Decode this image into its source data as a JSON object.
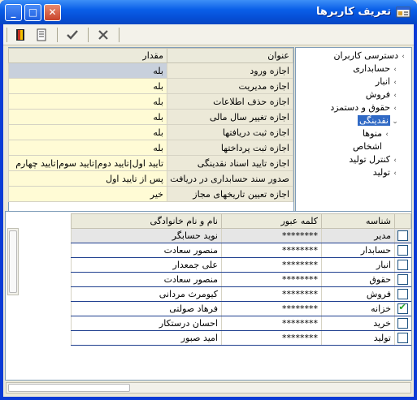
{
  "window": {
    "title": "تعریف کاربرها"
  },
  "tree": {
    "items": [
      {
        "label": "دسترسی کاربران",
        "arrow": "›",
        "indent": 0
      },
      {
        "label": "حسابداری",
        "arrow": "›",
        "indent": 1
      },
      {
        "label": "انبار",
        "arrow": "›",
        "indent": 1
      },
      {
        "label": "فروش",
        "arrow": "›",
        "indent": 1
      },
      {
        "label": "حقوق و دستمزد",
        "arrow": "›",
        "indent": 1
      },
      {
        "label": "نقدینگی",
        "arrow": "⌄",
        "indent": 1,
        "selected": true
      },
      {
        "label": "منوها",
        "arrow": "›",
        "indent": 2
      },
      {
        "label": "اشخاص",
        "arrow": "",
        "indent": 2
      },
      {
        "label": "کنترل تولید",
        "arrow": "›",
        "indent": 1
      },
      {
        "label": "تولید",
        "arrow": "›",
        "indent": 1
      }
    ]
  },
  "permissions": {
    "headers": {
      "title": "عنوان",
      "value": "مقدار"
    },
    "rows": [
      {
        "title": "اجازه ورود",
        "value": "بله"
      },
      {
        "title": "اجازه مدیریت",
        "value": "بله"
      },
      {
        "title": "اجازه حذف اطلاعات",
        "value": "بله"
      },
      {
        "title": "اجازه تغییر سال مالی",
        "value": "بله"
      },
      {
        "title": "اجازه ثبت دریافتها",
        "value": "بله"
      },
      {
        "title": "اجازه ثبت پرداختها",
        "value": "بله"
      },
      {
        "title": "اجازه تایید اسناد نقدینگی",
        "value": "تایید اول|تایید دوم|تایید سوم|تایید چهارم"
      },
      {
        "title": "صدور سند حسابداری در دریافت",
        "value": "پس از تایید اول"
      },
      {
        "title": "اجازه تعیین تاریخهای مجاز",
        "value": "خیر"
      }
    ]
  },
  "users": {
    "headers": {
      "id": "شناسه",
      "password": "کلمه عبور",
      "name": "نام و نام خانوادگی"
    },
    "rows": [
      {
        "id": "مدیر",
        "password": "********",
        "name": "نوید حسابگر",
        "checked": false
      },
      {
        "id": "حسابدار",
        "password": "********",
        "name": "منصور سعادت",
        "checked": false
      },
      {
        "id": "انبار",
        "password": "********",
        "name": "علی جمعدار",
        "checked": false
      },
      {
        "id": "حقوق",
        "password": "********",
        "name": "منصور سعادت",
        "checked": false
      },
      {
        "id": "فروش",
        "password": "********",
        "name": "کیومرث مردانی",
        "checked": false
      },
      {
        "id": "خزانه",
        "password": "********",
        "name": "فرهاد صولتی",
        "checked": true
      },
      {
        "id": "خرید",
        "password": "********",
        "name": "احسان درستکار",
        "checked": false
      },
      {
        "id": "تولید",
        "password": "********",
        "name": "امید صبور",
        "checked": false
      }
    ]
  },
  "icons": [
    "app-icon",
    "exit-door-icon",
    "document-icon",
    "checkmark-icon",
    "cancel-x-icon"
  ]
}
